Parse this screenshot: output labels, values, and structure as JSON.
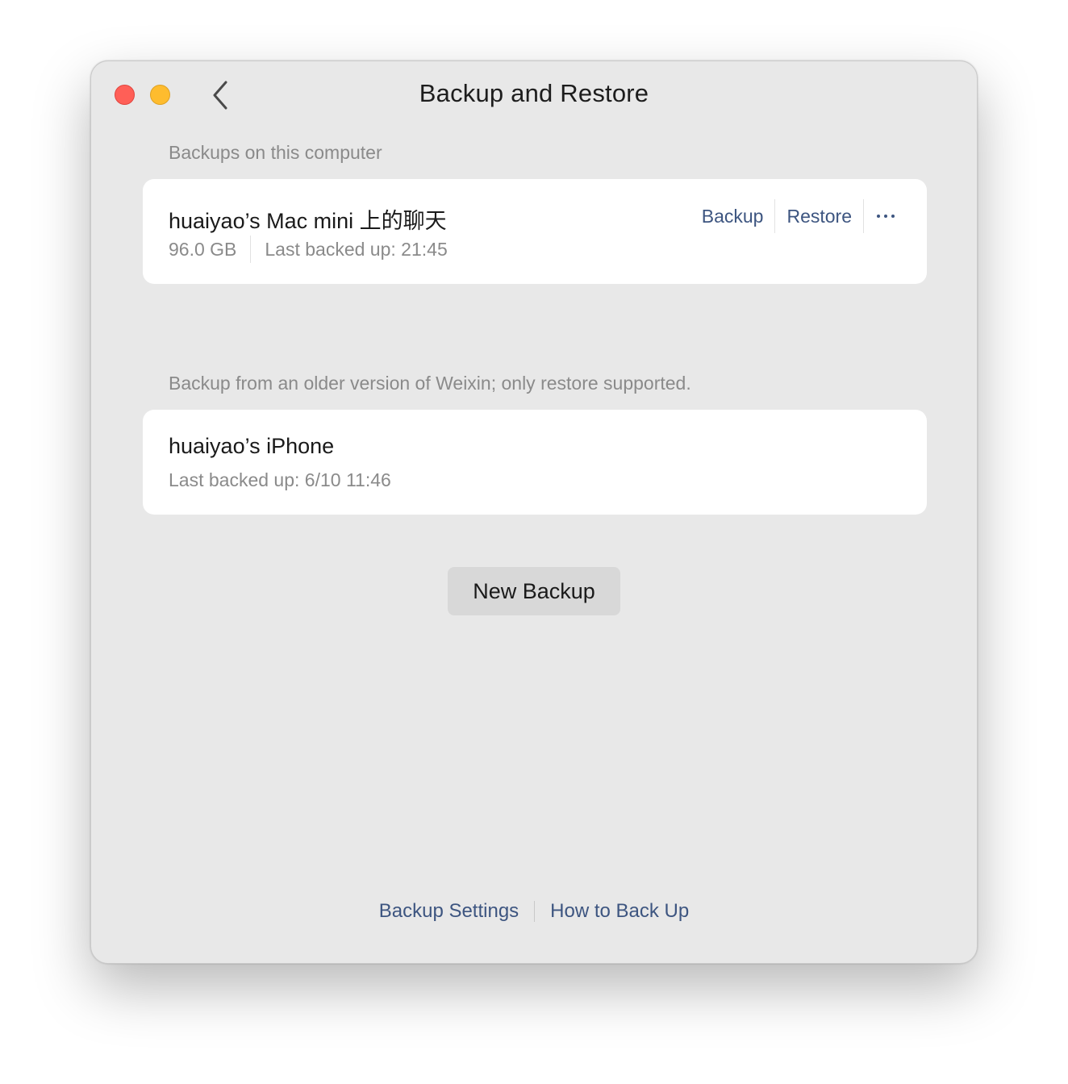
{
  "window": {
    "title": "Backup and Restore"
  },
  "local": {
    "section_label": "Backups on this computer",
    "item": {
      "title": "huaiyao’s Mac mini 上的聊天",
      "size": "96.0 GB",
      "last_backed_up": "Last backed up: 21:45",
      "backup_label": "Backup",
      "restore_label": "Restore"
    }
  },
  "legacy": {
    "section_label": "Backup from an older version of Weixin; only restore supported.",
    "item": {
      "title": "huaiyao’s iPhone",
      "last_backed_up": "Last backed up: 6/10 11:46"
    }
  },
  "new_backup_label": "New Backup",
  "footer": {
    "settings_label": "Backup Settings",
    "howto_label": "How to Back Up"
  },
  "colors": {
    "link": "#3d5580",
    "close": "#ff5f57",
    "minimize": "#febc2e"
  },
  "icons": [
    "close-icon",
    "minimize-icon",
    "chevron-left-icon",
    "more-icon"
  ]
}
